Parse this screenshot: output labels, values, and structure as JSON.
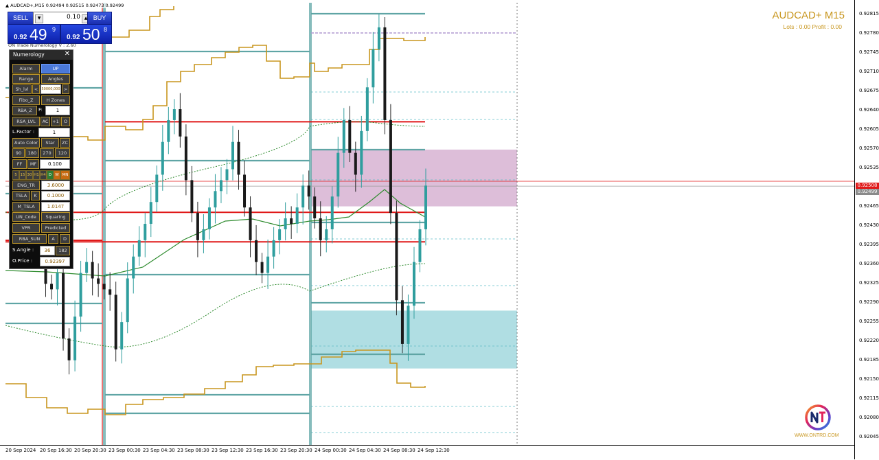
{
  "window": {
    "symbol_line": "▲ AUDCAD+,M15  0.92494 0.92515 0.92473 0.92499"
  },
  "trade_panel": {
    "sell_label": "SELL",
    "buy_label": "BUY",
    "lot_value": "0.10",
    "sell_price_small": "0.92",
    "sell_price_big": "49",
    "sell_price_sup": "9",
    "buy_price_small": "0.92",
    "buy_price_big": "50",
    "buy_price_sup": "8"
  },
  "indicator_version": "ON Trade Numerology V : 2.60",
  "numerology_panel": {
    "title": "Numerology",
    "close_glyph": "✕",
    "alarm": "Alarm",
    "up": "UP",
    "range": "Range",
    "angles": "Angles",
    "sh_lvl": "Sh_lvl",
    "lt": "<",
    "sh_value": "50000,000",
    "gt": ">",
    "fibo_z": "Fibo_Z",
    "h_zones": "H Zones",
    "rba_z": "RBA_Z",
    "f_label": "F:",
    "f_value": "1",
    "rsa_lvl": "RSA_LVL",
    "ac": "AC",
    "plus1": "+1",
    "o": "O",
    "l_factor_label": "L.Factor :",
    "l_factor_value": "1",
    "auto_color": "Auto Color",
    "star": "Star",
    "zc": "ZC",
    "n90": "90",
    "n180": "180",
    "n270": "270",
    "n120": "120",
    "ff": "FF",
    "mf": "MF",
    "ff_value": "0.100",
    "tf": [
      "5",
      "15",
      "30",
      "H1",
      "H4",
      "D",
      "W",
      "MN"
    ],
    "eng_tr": "ENG_TR",
    "eng_tr_value": "3.6000",
    "tsla": "TSLA",
    "k": "K",
    "tsla_value": "0.1000",
    "m_tsla": "M_TSLA",
    "m_tsla_value": "1.0147",
    "un_code": "UN_Code",
    "squaring": "Squaring",
    "vpr": "VPR",
    "predicted": "Predicted",
    "rba_sun": "RBA_SUN",
    "a": "A",
    "d": "D",
    "s_angle_label": "S.Angle :",
    "s_angle_value": "36",
    "s_angle_value2": "182",
    "o_price_label": "O.Price :",
    "o_price_value": "0.92397"
  },
  "header": {
    "symbol_title": "AUDCAD+ M15",
    "lots_profit": "Lots : 0.00 Profit : 0.00"
  },
  "price_axis": {
    "ticks": [
      "0.92815",
      "0.92780",
      "0.92745",
      "0.92710",
      "0.92675",
      "0.92640",
      "0.92605",
      "0.92570",
      "0.92535",
      "0.92500",
      "0.92465",
      "0.92430",
      "0.92395",
      "0.92360",
      "0.92325",
      "0.92290",
      "0.92255",
      "0.92220",
      "0.92185",
      "0.92150",
      "0.92115",
      "0.92080",
      "0.92045"
    ],
    "bid_tag": "0.92508",
    "ask_tag": "0.92499"
  },
  "time_axis": {
    "ticks": [
      "20 Sep 2024",
      "20 Sep 16:30",
      "20 Sep 20:30",
      "23 Sep 00:30",
      "23 Sep 04:30",
      "23 Sep 08:30",
      "23 Sep 12:30",
      "23 Sep 16:30",
      "23 Sep 20:30",
      "24 Sep 00:30",
      "24 Sep 04:30",
      "24 Sep 08:30",
      "24 Sep 12:30"
    ]
  },
  "logo": {
    "text": "WWW.ONTRD.COM"
  },
  "colors": {
    "teal_line": "#5fa5a5",
    "red_level": "#e01818",
    "gold_band": "#c8961e",
    "green_ma": "#2e8b2e",
    "candle": "#2f9e9e",
    "pink_zone": "#d7b3d2",
    "cyan_zone": "#a7dae0",
    "panel_blue": "#1a2fb0"
  },
  "chart_data": {
    "type": "candlestick",
    "symbol": "AUDCAD+",
    "timeframe": "M15",
    "ylim": [
      0.92025,
      0.92835
    ],
    "bid": 0.92499,
    "ask": 0.92508,
    "red_levels": [
      0.92617,
      0.92451,
      0.92397
    ],
    "pink_zone": [
      0.92462,
      0.92566
    ],
    "cyan_zone": [
      0.92165,
      0.92271
    ],
    "close_path": [
      0.9235,
      0.9232,
      0.9231,
      0.9234,
      0.9222,
      0.9218,
      0.9226,
      0.9234,
      0.9236,
      0.9233,
      0.9232,
      0.9231,
      0.923,
      0.922,
      0.9225,
      0.9233,
      0.9237,
      0.924,
      0.9243,
      0.9247,
      0.9252,
      0.9258,
      0.9262,
      0.9264,
      0.9259,
      0.9251,
      0.9245,
      0.924,
      0.9242,
      0.9246,
      0.9249,
      0.9251,
      0.9253,
      0.9258,
      0.9252,
      0.9246,
      0.924,
      0.9236,
      0.9234,
      0.9237,
      0.924,
      0.9242,
      0.9244,
      0.9243,
      0.9246,
      0.925,
      0.9248,
      0.9244,
      0.924,
      0.9242,
      0.9248,
      0.9256,
      0.9262,
      0.9256,
      0.9252,
      0.926,
      0.9268,
      0.9275,
      0.9279,
      0.9262,
      0.9245,
      0.9229,
      0.9221,
      0.9228,
      0.9236,
      0.9242,
      0.925
    ]
  }
}
